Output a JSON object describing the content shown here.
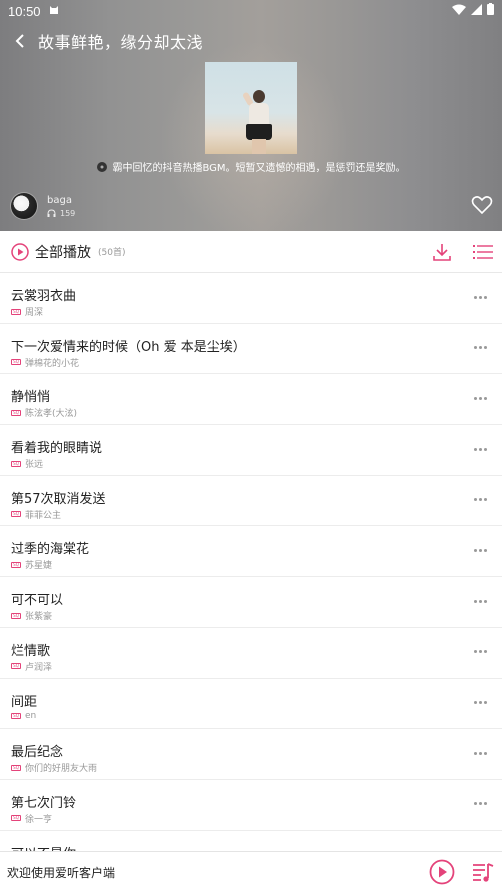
{
  "status": {
    "time": "10:50"
  },
  "header": {
    "back": "back",
    "title": "故事鲜艳，缘分却太浅",
    "description": "霸中回忆的抖音热播BGM。短暂又遗憾的相遇，是惩罚还是奖励。",
    "author": "baga",
    "plays": "159"
  },
  "toolbar": {
    "play_all_label": "全部播放",
    "count": "(50首)"
  },
  "songs": [
    {
      "title": "云裳羽衣曲",
      "artist": "周深"
    },
    {
      "title": "下一次爱情来的时候（Oh 爱 本是尘埃）",
      "artist": "弹棉花的小花"
    },
    {
      "title": "静悄悄",
      "artist": "陈泫孝(大泫)"
    },
    {
      "title": "看着我的眼睛说",
      "artist": "张远"
    },
    {
      "title": "第57次取消发送",
      "artist": "菲菲公主"
    },
    {
      "title": "过季的海棠花",
      "artist": "苏星婕"
    },
    {
      "title": "可不可以",
      "artist": "张紫豪"
    },
    {
      "title": "烂情歌",
      "artist": "卢润泽"
    },
    {
      "title": "间距",
      "artist": "en"
    },
    {
      "title": "最后纪念",
      "artist": "你们的好朋友大雨"
    },
    {
      "title": "第七次门铃",
      "artist": "徐一亨"
    },
    {
      "title": "可以不是你",
      "artist": ""
    }
  ],
  "player": {
    "text": "欢迎使用爱听客户端"
  },
  "colors": {
    "accent": "#e4437a",
    "header_bg": "#929292"
  }
}
